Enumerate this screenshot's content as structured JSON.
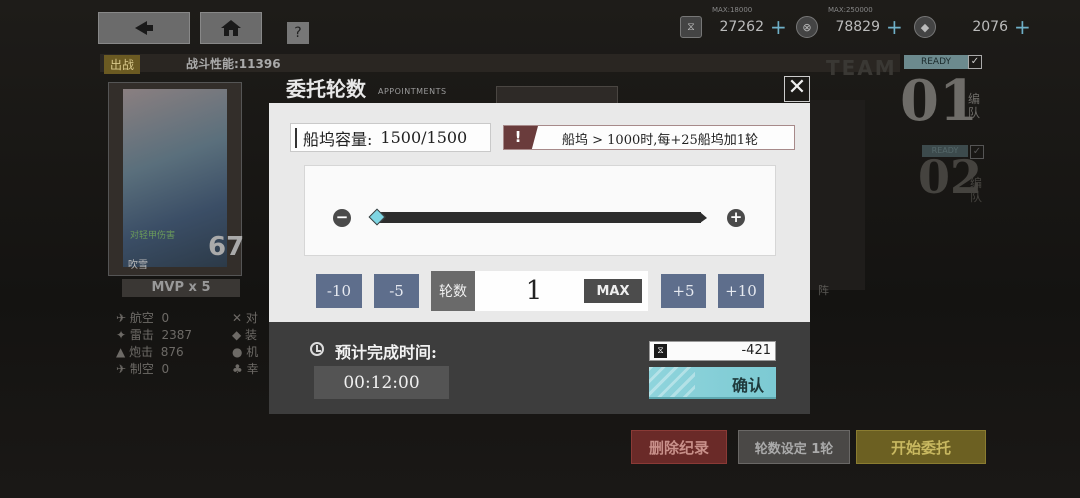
{
  "topbar": {
    "back_icon": "back-arrow-icon",
    "home_icon": "home-icon",
    "help_label": "?",
    "resources": [
      {
        "icon": "dock-icon",
        "max": "MAX:18000",
        "value": "27262",
        "plus": "+"
      },
      {
        "icon": "material-icon",
        "max": "MAX:250000",
        "value": "78829",
        "plus": "+"
      },
      {
        "icon": "diamond-icon",
        "max": "",
        "value": "2076",
        "plus": "+"
      }
    ]
  },
  "background": {
    "sortie_label": "出战",
    "combat_power": "战斗性能:11396",
    "team_word": "TEAM",
    "team1_status": "READY",
    "team1_number": "01",
    "team1_label": "编队",
    "team2_status": "READY",
    "team2_number": "02",
    "team2_label": "编队",
    "card_level": "67",
    "card_name": "吹雪",
    "card_type": "对轻甲伤害",
    "mvp": "MVP x 5",
    "stats_left": [
      {
        "name": "航空",
        "value": "0"
      },
      {
        "name": "雷击",
        "value": "2387"
      },
      {
        "name": "炮击",
        "value": "876"
      },
      {
        "name": "制空",
        "value": "0"
      }
    ],
    "stats_right": [
      "对",
      "装",
      "机",
      "幸"
    ],
    "formation": "阵"
  },
  "dialog": {
    "title": "委托轮数",
    "subtitle": "APPOINTMENTS",
    "close_label": "✕",
    "dock_capacity_label": "船坞容量:",
    "dock_capacity_value": "1500/1500",
    "warning_icon": "!",
    "warning_text": "船坞 > 1000时,每+25船坞加1轮",
    "slider_min_label": "−",
    "slider_max_label": "+",
    "slider_value_fraction": 0.0,
    "steps": {
      "m10": "-10",
      "m5": "-5",
      "p5": "+5",
      "p10": "+10"
    },
    "rounds_label": "轮数",
    "rounds_value": "1",
    "max_label": "MAX",
    "eta_label": "预计完成时间:",
    "eta_value": "00:12:00",
    "cost_value": "-421",
    "confirm_label": "确认"
  },
  "bottom_buttons": {
    "delete": "删除纪录",
    "rounds_setting": "轮数设定 1轮",
    "start": "开始委托"
  }
}
